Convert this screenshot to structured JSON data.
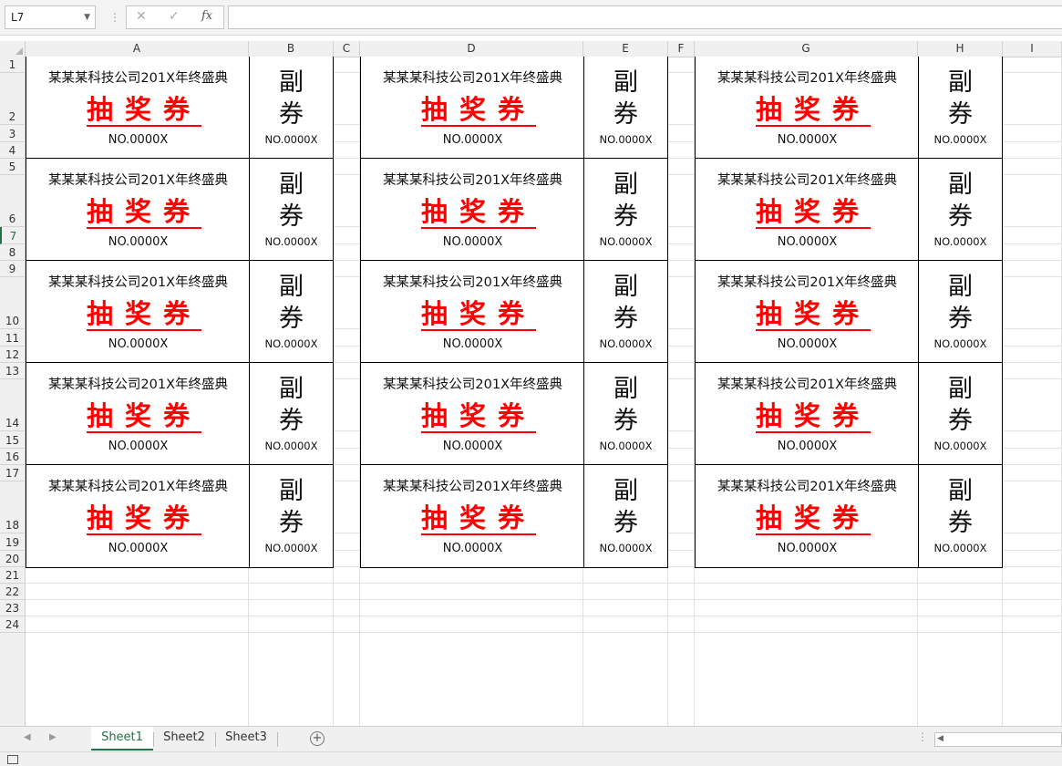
{
  "formula_bar": {
    "name_box": "L7",
    "cancel_icon": "✕",
    "enter_icon": "✓",
    "fx_label": "fx",
    "formula": ""
  },
  "columns": [
    "A",
    "B",
    "C",
    "D",
    "E",
    "F",
    "G",
    "H",
    "I"
  ],
  "rows": [
    "1",
    "2",
    "3",
    "4",
    "5",
    "6",
    "7",
    "8",
    "9",
    "10",
    "11",
    "12",
    "13",
    "14",
    "15",
    "16",
    "17",
    "18",
    "19",
    "20",
    "21",
    "22",
    "23",
    "24"
  ],
  "ticket": {
    "title": "某某某科技公司201X年终盛典",
    "main": "抽奖券",
    "number": "NO.0000X",
    "stub_top": "副",
    "stub_bottom": "券",
    "stub_number": "NO.0000X"
  },
  "ticket_grid": {
    "ticket_rows": 5,
    "ticket_columns": 3
  },
  "sheets": [
    {
      "name": "Sheet1",
      "active": true
    },
    {
      "name": "Sheet2",
      "active": false
    },
    {
      "name": "Sheet3",
      "active": false
    }
  ],
  "colors": {
    "accent": "#217346",
    "ticket_red": "#ff0000"
  }
}
